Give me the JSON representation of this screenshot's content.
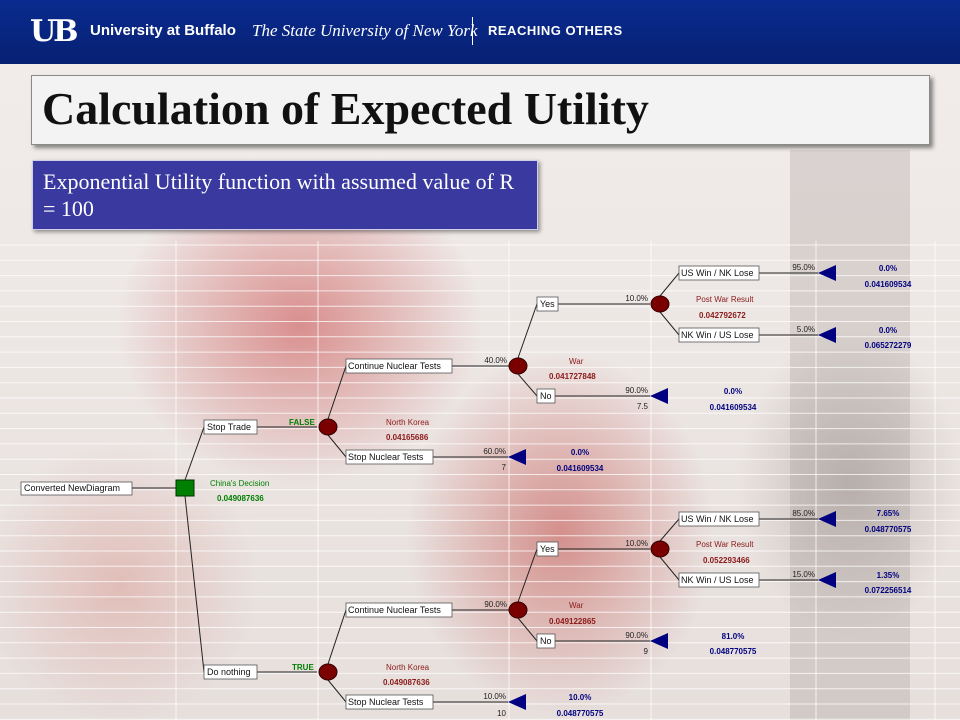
{
  "header": {
    "logo": "UB",
    "university": "University at Buffalo",
    "suny": "The State University of New York",
    "tagline": "REACHING OTHERS"
  },
  "title": "Calculation of Expected Utility",
  "subtitle": "Exponential Utility function with assumed value of R = 100",
  "colors": {
    "header_blue": "#0a2b8f",
    "subtitle_bg": "#3939a0",
    "decision_node": "#008000",
    "chance_node": "#7a0000",
    "terminal_node": "#000080",
    "branch_green_label": "#008000",
    "chance_label": "#8b1a1a",
    "terminal_label": "#000080"
  },
  "tree": {
    "root": {
      "label": "Converted NewDiagram"
    },
    "decision": {
      "name": "China's Decision",
      "value": "0.049087636"
    },
    "nodes": [
      {
        "id": "stop_trade",
        "label": "Stop Trade",
        "tag": "FALSE",
        "chance_name": "North Korea",
        "chance_value": "0.04165686"
      },
      {
        "id": "do_nothing",
        "label": "Do nothing",
        "tag": "TRUE",
        "chance_name": "North Korea",
        "chance_value": "0.049087636"
      },
      {
        "id": "cnt1",
        "label": "Continue Nuclear Tests",
        "prob": "40.0%",
        "chance_name": "War",
        "chance_value": "0.041727848"
      },
      {
        "id": "snt1",
        "label": "Stop Nuclear Tests",
        "prob": "60.0%",
        "payoff": "7",
        "term_prob": "0.0%",
        "term_value": "0.041609534"
      },
      {
        "id": "yes1",
        "label": "Yes",
        "prob": "10.0%",
        "chance_name": "Post War Result",
        "chance_value": "0.042792672"
      },
      {
        "id": "no1",
        "label": "No",
        "prob": "90.0%",
        "payoff": "7.5",
        "term_prob": "0.0%",
        "term_value": "0.041609534"
      },
      {
        "id": "uswin1",
        "label": "US Win / NK Lose",
        "prob": "95.0%",
        "term_prob": "0.0%",
        "term_value": "0.041609534"
      },
      {
        "id": "nkwin1",
        "label": "NK Win / US Lose",
        "prob": "5.0%",
        "term_prob": "0.0%",
        "term_value": "0.065272279"
      },
      {
        "id": "cnt2",
        "label": "Continue Nuclear Tests",
        "prob": "90.0%",
        "chance_name": "War",
        "chance_value": "0.049122865"
      },
      {
        "id": "snt2",
        "label": "Stop Nuclear Tests",
        "prob": "10.0%",
        "payoff": "10",
        "term_prob": "10.0%",
        "term_value": "0.048770575"
      },
      {
        "id": "yes2",
        "label": "Yes",
        "prob": "10.0%",
        "chance_name": "Post War Result",
        "chance_value": "0.052293466"
      },
      {
        "id": "no2",
        "label": "No",
        "prob": "90.0%",
        "payoff": "9",
        "term_prob": "81.0%",
        "term_value": "0.048770575"
      },
      {
        "id": "uswin2",
        "label": "US Win / NK Lose",
        "prob": "85.0%",
        "term_prob": "7.65%",
        "term_value": "0.048770575"
      },
      {
        "id": "nkwin2",
        "label": "NK Win / US Lose",
        "prob": "15.0%",
        "term_prob": "1.35%",
        "term_value": "0.072256514"
      }
    ]
  }
}
